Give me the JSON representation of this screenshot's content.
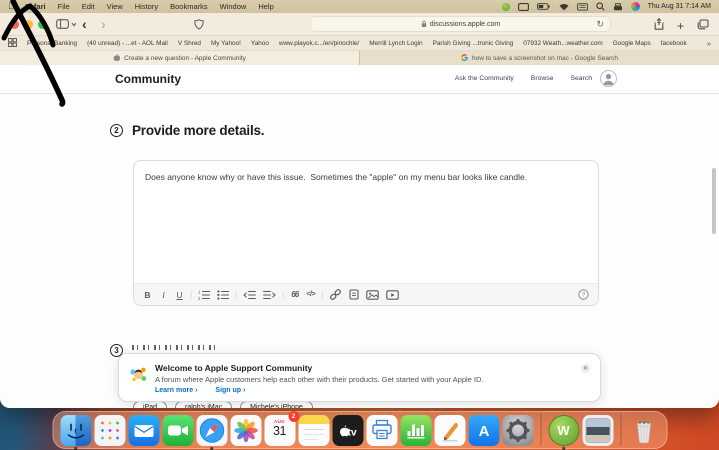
{
  "annotation": {
    "description": "hand-drawn black arrow pointing at the Apple menu-bar logo",
    "color": "#000000"
  },
  "menu_bar": {
    "apple_logo": "apple-icon",
    "app_name": "Safari",
    "menus": [
      "File",
      "Edit",
      "View",
      "History",
      "Bookmarks",
      "Window",
      "Help"
    ],
    "status_icons": [
      "webroot-icon",
      "display-icon",
      "battery-icon",
      "wifi-icon",
      "keyboard-icon",
      "spotlight-icon",
      "printer-icon",
      "siri-icon"
    ],
    "clock": "Thu Aug 31  7:14 AM"
  },
  "browser": {
    "toolbar": {
      "address": "discussions.apple.com"
    },
    "bookmarks_bar": {
      "items": [
        "Personal Banking",
        "(40 unread) - ...et - AOL Mail",
        "V Shred",
        "My Yahoo!",
        "Yahoo",
        "www.playok.c.../en/pinochle/",
        "Merrill Lynch Login",
        "Parish Giving ...tronic Giving",
        "07932 Weath...weather.com",
        "Google Maps",
        "facebook"
      ],
      "overflow": "»"
    },
    "tabs": [
      {
        "icon": "apple",
        "title": "Create a new question - Apple Community",
        "active": true
      },
      {
        "icon": "google",
        "title": "how to save a screenshot on mac - Google Search",
        "active": false
      }
    ]
  },
  "page": {
    "header": {
      "title": "Community",
      "nav": [
        "Ask the Community",
        "Browse",
        "Search"
      ]
    },
    "step2": {
      "number": "2",
      "title": "Provide more details."
    },
    "editor": {
      "text": "Does anyone know why or have this issue.  Sometimes the \"apple\" on my menu bar looks like candle.",
      "toolbar_groups": [
        [
          "bold",
          "italic",
          "underline"
        ],
        [
          "ordered-list",
          "bullet-list"
        ],
        [
          "outdent",
          "indent"
        ],
        [
          "quote",
          "code"
        ],
        [
          "link",
          "attachment",
          "image",
          "video"
        ]
      ],
      "help": "help"
    },
    "step3": {
      "number": "3"
    },
    "welcome": {
      "title": "Welcome to Apple Support Community",
      "body": "A forum where Apple customers help each other with their products. Get started with your Apple ID.",
      "learn_more": "Learn more ›",
      "sign_up": "Sign up ›"
    },
    "pills": [
      "iPad",
      "ralph's iMac",
      "Michele's iPhone"
    ]
  },
  "dock": {
    "apps": [
      {
        "id": "finder",
        "name": "Finder",
        "running": true
      },
      {
        "id": "launchpad",
        "name": "Launchpad"
      },
      {
        "id": "mail",
        "name": "Mail"
      },
      {
        "id": "facetime",
        "name": "FaceTime"
      },
      {
        "id": "safari",
        "name": "Safari",
        "running": true
      },
      {
        "id": "photos",
        "name": "Photos"
      },
      {
        "id": "calendar",
        "name": "Calendar",
        "label_top": "AUG",
        "label_num": "31",
        "badge": "2"
      },
      {
        "id": "notes",
        "name": "Notes"
      },
      {
        "id": "appletv",
        "name": "Apple TV"
      },
      {
        "id": "printer",
        "name": "Printer"
      },
      {
        "id": "numbers",
        "name": "Numbers"
      },
      {
        "id": "pages",
        "name": "Pages"
      },
      {
        "id": "appstore",
        "name": "App Store"
      },
      {
        "id": "settings",
        "name": "System Preferences"
      },
      {
        "id": "sep"
      },
      {
        "id": "webroot",
        "name": "Webroot",
        "running": true,
        "letter": "W"
      },
      {
        "id": "downloads",
        "name": "Downloads"
      },
      {
        "id": "sep"
      },
      {
        "id": "trash",
        "name": "Trash"
      }
    ]
  }
}
